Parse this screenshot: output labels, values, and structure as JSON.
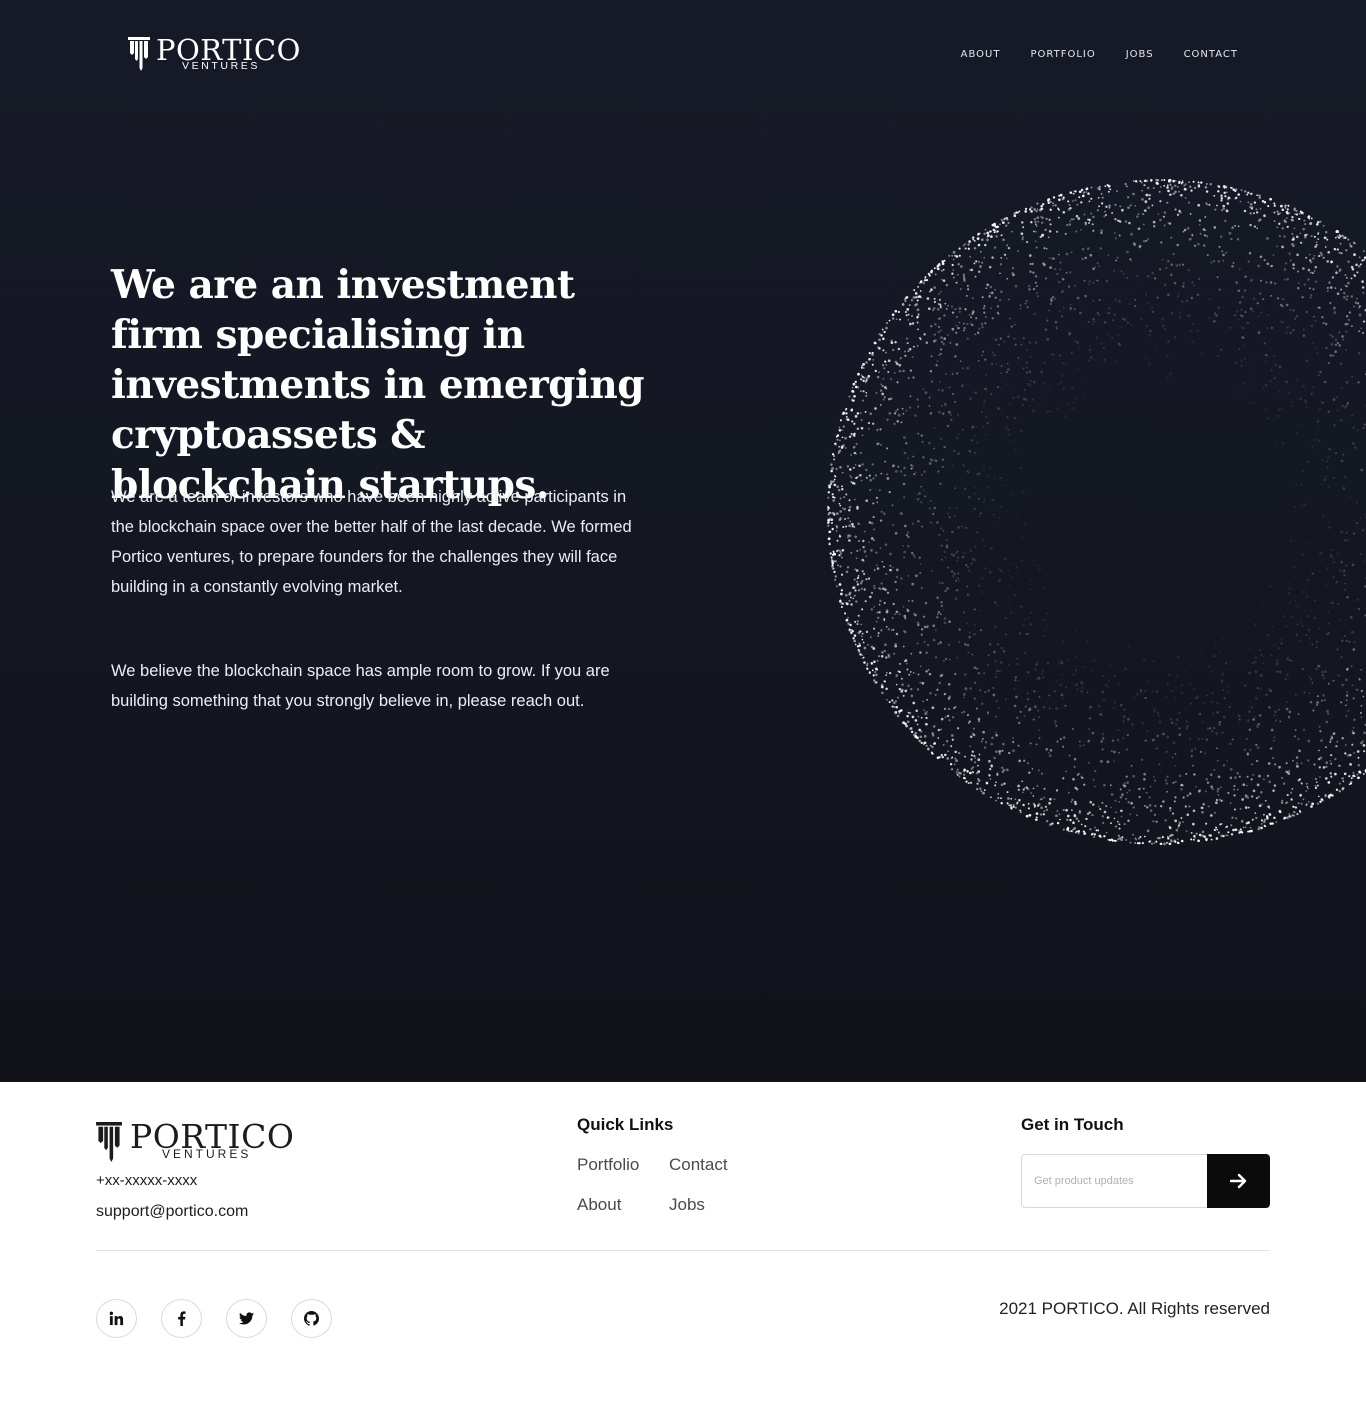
{
  "brand": {
    "name": "PORTICO",
    "sub": "VENTURES"
  },
  "nav": {
    "items": [
      "ABOUT",
      "PORTFOLIO",
      "JOBS",
      "CONTACT"
    ]
  },
  "hero": {
    "headline_regular": "We are an investment firm specialising in investments in emerging",
    "headline_bold": "cryptoassets & blockchain startups.",
    "paragraph_1": "We are a team of investors who have been highly active participants in the blockchain space over the better half of the last decade. We formed Portico ventures, to prepare founders for the challenges they will face building in a constantly evolving market.",
    "paragraph_2": "We believe the blockchain space has ample room to grow. If you are building something that you strongly believe in, please reach out."
  },
  "footer": {
    "phone": "+xx-xxxxx-xxxx",
    "email": "support@portico.com",
    "quick_links_title": "Quick Links",
    "quick_links": [
      "Portfolio",
      "Contact",
      "About",
      "Jobs"
    ],
    "get_in_touch_title": "Get in Touch",
    "subscribe_placeholder": "Get product updates",
    "social": [
      "linkedin-icon",
      "facebook-icon",
      "twitter-icon",
      "github-icon"
    ],
    "copyright": "2021 PORTICO. All Rights reserved"
  },
  "colors": {
    "hero_bg": "#151823",
    "text_light": "#ffffff",
    "button_dark": "#0b0b0b",
    "footer_bg": "#ffffff"
  }
}
